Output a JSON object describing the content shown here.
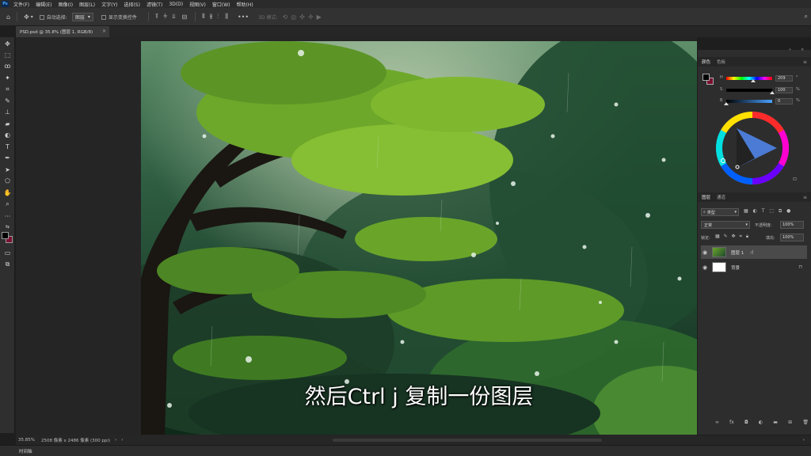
{
  "app": {
    "logo": "Ps"
  },
  "menu": [
    "文件(F)",
    "编辑(E)",
    "图像(I)",
    "图层(L)",
    "文字(Y)",
    "选择(S)",
    "滤镜(T)",
    "3D(D)",
    "视图(V)",
    "窗口(W)",
    "帮助(H)"
  ],
  "options": {
    "auto_select_label": "自动选择:",
    "auto_select_value": "图层",
    "show_transform_label": "显示变换控件",
    "mode_3d_label": "3D 模式:"
  },
  "document": {
    "tab_title": "PSD.psd @ 35.8% (图层 1, RGB/8)"
  },
  "color_panel": {
    "tabs": [
      "颜色",
      "色板"
    ],
    "h": {
      "label": "H",
      "value": "209",
      "unit": "°",
      "fraction": 0.58
    },
    "s": {
      "label": "S",
      "value": "100",
      "unit": "%",
      "fraction": 1.0
    },
    "b": {
      "label": "B",
      "value": "0",
      "unit": "%",
      "fraction": 0.0
    },
    "fg_color": "#000000",
    "bg_color": "#7a1030"
  },
  "layers_panel": {
    "tabs": [
      "图层",
      "通道"
    ],
    "filter_label": "类型",
    "blend_mode": "正常",
    "opacity_label": "不透明度:",
    "opacity_value": "100%",
    "lock_label": "锁定:",
    "fill_label": "填充:",
    "fill_value": "100%",
    "layers": [
      {
        "name": "图层 1",
        "selected": true
      },
      {
        "name": "背景",
        "selected": false
      }
    ]
  },
  "status": {
    "zoom": "35.85%",
    "doc_info": "2508 像素 x 2486 像素 (300 ppi)"
  },
  "timeline_label": "时间轴",
  "subtitle": "然后Ctrl j 复制一份图层"
}
